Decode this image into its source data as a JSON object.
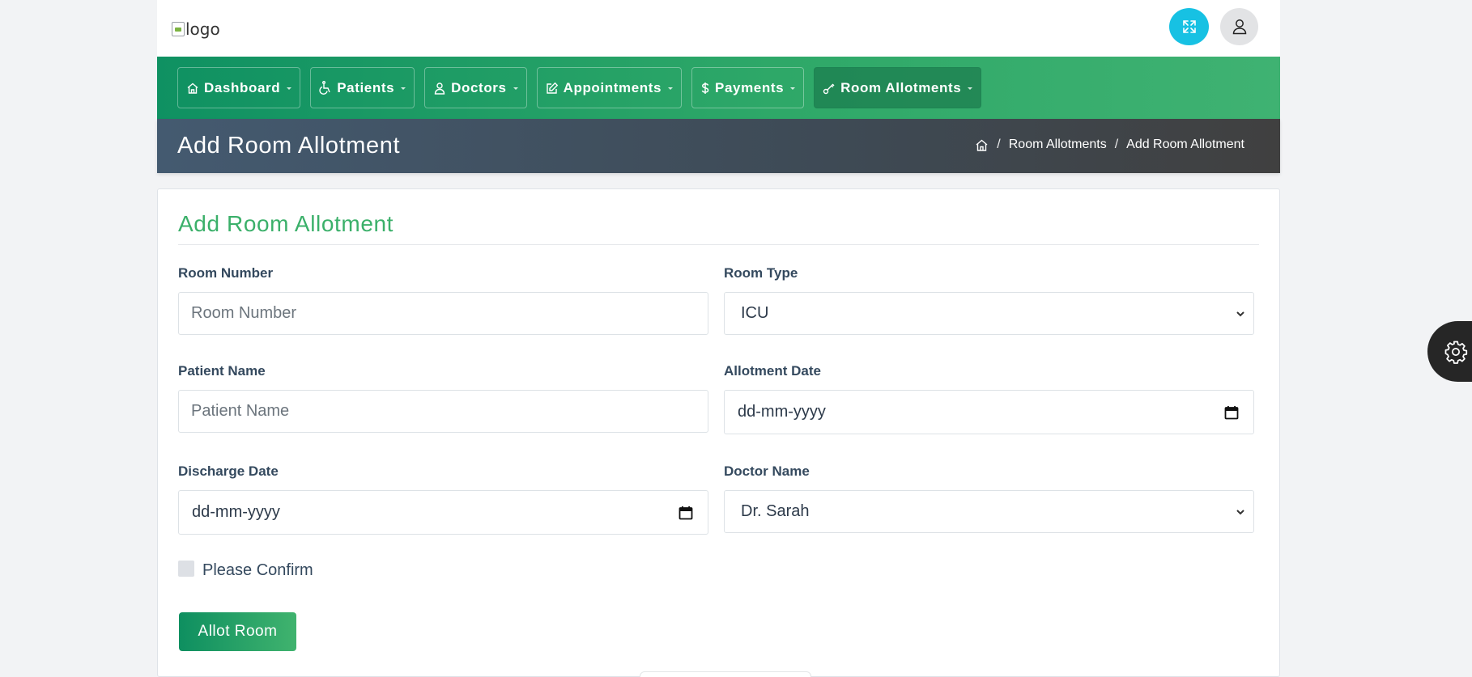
{
  "header": {
    "logo_alt": "logo"
  },
  "nav": {
    "items": [
      {
        "label": "Dashboard",
        "icon": "home-icon"
      },
      {
        "label": "Patients",
        "icon": "wheelchair-icon"
      },
      {
        "label": "Doctors",
        "icon": "doctor-icon"
      },
      {
        "label": "Appointments",
        "icon": "edit-icon"
      },
      {
        "label": "Payments",
        "icon": "dollar-icon"
      },
      {
        "label": "Room Allotments",
        "icon": "key-icon",
        "active": true
      }
    ]
  },
  "page": {
    "title": "Add Room Allotment",
    "breadcrumb": [
      "Room Allotments",
      "Add Room Allotment"
    ],
    "breadcrumb_separator": "/"
  },
  "form": {
    "title": "Add Room Allotment",
    "room_number": {
      "label": "Room Number",
      "placeholder": "Room Number"
    },
    "room_type": {
      "label": "Room Type",
      "value": "ICU"
    },
    "patient_name": {
      "label": "Patient Name",
      "placeholder": "Patient Name"
    },
    "allotment_date": {
      "label": "Allotment Date",
      "value": "dd-mm-yyyy"
    },
    "discharge_date": {
      "label": "Discharge Date",
      "value": "dd-mm-yyyy"
    },
    "doctor_name": {
      "label": "Doctor Name",
      "value": "Dr. Sarah"
    },
    "confirm_label": "Please Confirm",
    "submit_label": "Allot Room"
  },
  "colors": {
    "accent": "#3bb06a",
    "nav_start": "#0f9162",
    "nav_end": "#3fb272",
    "fullscreen_button": "#17c1e3"
  }
}
